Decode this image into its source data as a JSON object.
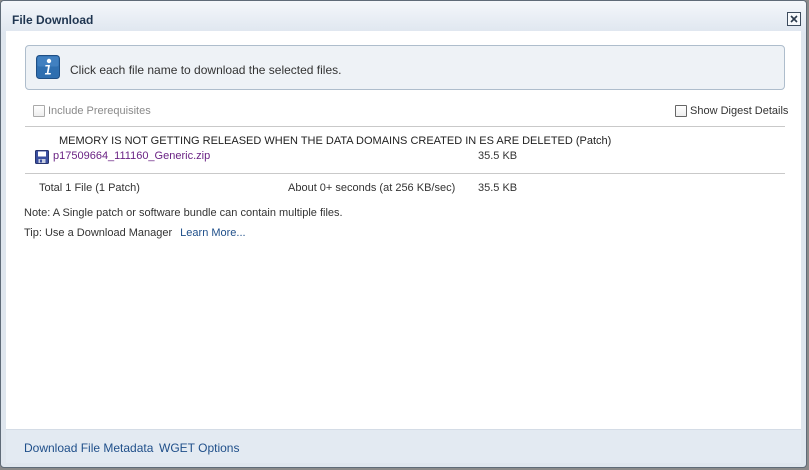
{
  "dialog": {
    "title": "File Download",
    "close_icon": "close-icon"
  },
  "info": {
    "icon": "info-icon",
    "message": "Click each file name to download the selected files."
  },
  "options": {
    "include_prerequisites": "Include Prerequisites",
    "show_digest_details": "Show Digest Details"
  },
  "patch": {
    "description": "MEMORY IS NOT GETTING RELEASED WHEN THE DATA DOMAINS CREATED IN ES ARE DELETED (Patch)",
    "file_icon": "save-icon",
    "file_name": "p17509664_111160_Generic.zip",
    "file_size": "35.5 KB"
  },
  "summary": {
    "total_label": "Total 1 File (1 Patch)",
    "time_estimate": "About 0+ seconds (at 256 KB/sec)",
    "total_size": "35.5 KB"
  },
  "notes": {
    "note": "Note: A Single patch or software bundle can contain multiple files.",
    "tip": "Tip: Use a Download Manager",
    "learn_more": "Learn More..."
  },
  "footer": {
    "download_metadata": "Download File Metadata",
    "wget_options": "WGET Options"
  },
  "colors": {
    "link": "#1f4f8a",
    "file_link": "#6a2384",
    "info_icon": "#2f6fb0"
  }
}
